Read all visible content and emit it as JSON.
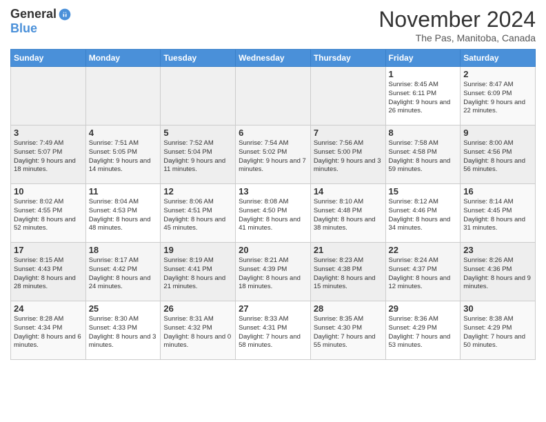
{
  "logo": {
    "general": "General",
    "blue": "Blue"
  },
  "title": "November 2024",
  "location": "The Pas, Manitoba, Canada",
  "days_of_week": [
    "Sunday",
    "Monday",
    "Tuesday",
    "Wednesday",
    "Thursday",
    "Friday",
    "Saturday"
  ],
  "weeks": [
    [
      {
        "day": "",
        "info": ""
      },
      {
        "day": "",
        "info": ""
      },
      {
        "day": "",
        "info": ""
      },
      {
        "day": "",
        "info": ""
      },
      {
        "day": "",
        "info": ""
      },
      {
        "day": "1",
        "info": "Sunrise: 8:45 AM\nSunset: 6:11 PM\nDaylight: 9 hours and 26 minutes."
      },
      {
        "day": "2",
        "info": "Sunrise: 8:47 AM\nSunset: 6:09 PM\nDaylight: 9 hours and 22 minutes."
      }
    ],
    [
      {
        "day": "3",
        "info": "Sunrise: 7:49 AM\nSunset: 5:07 PM\nDaylight: 9 hours and 18 minutes."
      },
      {
        "day": "4",
        "info": "Sunrise: 7:51 AM\nSunset: 5:05 PM\nDaylight: 9 hours and 14 minutes."
      },
      {
        "day": "5",
        "info": "Sunrise: 7:52 AM\nSunset: 5:04 PM\nDaylight: 9 hours and 11 minutes."
      },
      {
        "day": "6",
        "info": "Sunrise: 7:54 AM\nSunset: 5:02 PM\nDaylight: 9 hours and 7 minutes."
      },
      {
        "day": "7",
        "info": "Sunrise: 7:56 AM\nSunset: 5:00 PM\nDaylight: 9 hours and 3 minutes."
      },
      {
        "day": "8",
        "info": "Sunrise: 7:58 AM\nSunset: 4:58 PM\nDaylight: 8 hours and 59 minutes."
      },
      {
        "day": "9",
        "info": "Sunrise: 8:00 AM\nSunset: 4:56 PM\nDaylight: 8 hours and 56 minutes."
      }
    ],
    [
      {
        "day": "10",
        "info": "Sunrise: 8:02 AM\nSunset: 4:55 PM\nDaylight: 8 hours and 52 minutes."
      },
      {
        "day": "11",
        "info": "Sunrise: 8:04 AM\nSunset: 4:53 PM\nDaylight: 8 hours and 48 minutes."
      },
      {
        "day": "12",
        "info": "Sunrise: 8:06 AM\nSunset: 4:51 PM\nDaylight: 8 hours and 45 minutes."
      },
      {
        "day": "13",
        "info": "Sunrise: 8:08 AM\nSunset: 4:50 PM\nDaylight: 8 hours and 41 minutes."
      },
      {
        "day": "14",
        "info": "Sunrise: 8:10 AM\nSunset: 4:48 PM\nDaylight: 8 hours and 38 minutes."
      },
      {
        "day": "15",
        "info": "Sunrise: 8:12 AM\nSunset: 4:46 PM\nDaylight: 8 hours and 34 minutes."
      },
      {
        "day": "16",
        "info": "Sunrise: 8:14 AM\nSunset: 4:45 PM\nDaylight: 8 hours and 31 minutes."
      }
    ],
    [
      {
        "day": "17",
        "info": "Sunrise: 8:15 AM\nSunset: 4:43 PM\nDaylight: 8 hours and 28 minutes."
      },
      {
        "day": "18",
        "info": "Sunrise: 8:17 AM\nSunset: 4:42 PM\nDaylight: 8 hours and 24 minutes."
      },
      {
        "day": "19",
        "info": "Sunrise: 8:19 AM\nSunset: 4:41 PM\nDaylight: 8 hours and 21 minutes."
      },
      {
        "day": "20",
        "info": "Sunrise: 8:21 AM\nSunset: 4:39 PM\nDaylight: 8 hours and 18 minutes."
      },
      {
        "day": "21",
        "info": "Sunrise: 8:23 AM\nSunset: 4:38 PM\nDaylight: 8 hours and 15 minutes."
      },
      {
        "day": "22",
        "info": "Sunrise: 8:24 AM\nSunset: 4:37 PM\nDaylight: 8 hours and 12 minutes."
      },
      {
        "day": "23",
        "info": "Sunrise: 8:26 AM\nSunset: 4:36 PM\nDaylight: 8 hours and 9 minutes."
      }
    ],
    [
      {
        "day": "24",
        "info": "Sunrise: 8:28 AM\nSunset: 4:34 PM\nDaylight: 8 hours and 6 minutes."
      },
      {
        "day": "25",
        "info": "Sunrise: 8:30 AM\nSunset: 4:33 PM\nDaylight: 8 hours and 3 minutes."
      },
      {
        "day": "26",
        "info": "Sunrise: 8:31 AM\nSunset: 4:32 PM\nDaylight: 8 hours and 0 minutes."
      },
      {
        "day": "27",
        "info": "Sunrise: 8:33 AM\nSunset: 4:31 PM\nDaylight: 7 hours and 58 minutes."
      },
      {
        "day": "28",
        "info": "Sunrise: 8:35 AM\nSunset: 4:30 PM\nDaylight: 7 hours and 55 minutes."
      },
      {
        "day": "29",
        "info": "Sunrise: 8:36 AM\nSunset: 4:29 PM\nDaylight: 7 hours and 53 minutes."
      },
      {
        "day": "30",
        "info": "Sunrise: 8:38 AM\nSunset: 4:29 PM\nDaylight: 7 hours and 50 minutes."
      }
    ]
  ]
}
